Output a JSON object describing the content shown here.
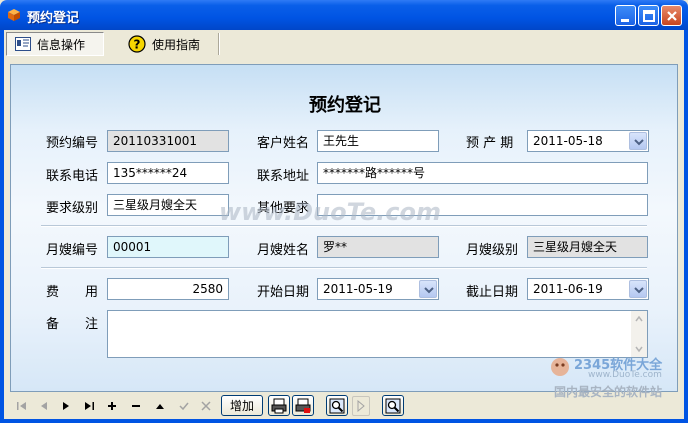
{
  "window": {
    "title": "预约登记"
  },
  "tabs": [
    {
      "label": "信息操作",
      "icon": "id-card-icon",
      "active": true
    },
    {
      "label": "使用指南",
      "icon": "help-icon",
      "active": false
    }
  ],
  "form": {
    "heading": "预约登记",
    "booking_no": {
      "label": "预约编号",
      "value": "20110331001"
    },
    "customer_name": {
      "label": "客户姓名",
      "value": "王先生"
    },
    "due_date": {
      "label": "预 产 期",
      "value": "2011-05-18"
    },
    "phone": {
      "label": "联系电话",
      "value": "135******24"
    },
    "address": {
      "label": "联系地址",
      "value": "*******路******号"
    },
    "level_required": {
      "label": "要求级别",
      "value": "三星级月嫂全天"
    },
    "other_requirements": {
      "label": "其他要求",
      "value": ""
    },
    "nanny_no": {
      "label": "月嫂编号",
      "value": "00001"
    },
    "nanny_name": {
      "label": "月嫂姓名",
      "value": "罗**"
    },
    "nanny_level": {
      "label": "月嫂级别",
      "value": "三星级月嫂全天"
    },
    "fee": {
      "label": "费　　用",
      "value": "2580"
    },
    "start_date": {
      "label": "开始日期",
      "value": "2011-05-19"
    },
    "end_date": {
      "label": "截止日期",
      "value": "2011-06-19"
    },
    "remarks": {
      "label": "备　　注",
      "value": ""
    }
  },
  "navigator": {
    "add_label": "增加"
  },
  "watermarks": {
    "duote": "www.DuoTe.com",
    "brand": "2345软件大全",
    "brand_url": "www.DuoTe.com",
    "slogan": "国内最安全的软件站"
  },
  "colors": {
    "title_bar": "#0054E3",
    "panel_top": "#C6DFF4",
    "panel_mid": "#F3F8FD",
    "field_border": "#7F9DB9"
  }
}
